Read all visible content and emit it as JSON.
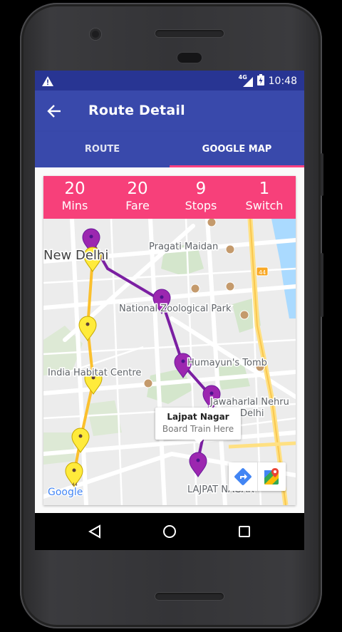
{
  "status_bar": {
    "time": "10:48",
    "network": "4G",
    "icons": [
      "warning-icon",
      "signal-icon",
      "battery-icon"
    ]
  },
  "app_bar": {
    "title": "Route Detail",
    "back_icon": "arrow-back-icon"
  },
  "tabs": [
    {
      "label": "ROUTE",
      "selected": false
    },
    {
      "label": "GOOGLE MAP",
      "selected": true
    }
  ],
  "stats": [
    {
      "value": "20",
      "label": "Mins"
    },
    {
      "value": "20",
      "label": "Fare"
    },
    {
      "value": "9",
      "label": "Stops"
    },
    {
      "value": "1",
      "label": "Switch"
    }
  ],
  "map": {
    "labels": {
      "new_delhi": "New Delhi",
      "pragati_maidan": "Pragati Maidan",
      "zoo": "National Zoological Park",
      "humayun": "Humayun's Tomb",
      "habitat": "India Habitat Centre",
      "jln": "Jawaharlal Nehru",
      "delhi": "Delhi",
      "lajpat_area": "LAJPAT NAGAR",
      "road_44": "44",
      "road_44_small": "44"
    },
    "callout": {
      "title": "Lajpat Nagar",
      "subtitle": "Board Train Here"
    },
    "google_logo": "Google",
    "colors": {
      "purple_line": "#7b1fa2",
      "yellow_line": "#fdd835",
      "purple_pin": "#9c27b0",
      "yellow_pin": "#ffeb3b"
    }
  },
  "nav_bar": {
    "icons": [
      "back-triangle-icon",
      "home-circle-icon",
      "recents-square-icon"
    ]
  },
  "theme": {
    "primary": "#3949ab",
    "primary_dark": "#283593",
    "accent": "#ff4081",
    "stats_bg": "#f7407a"
  }
}
